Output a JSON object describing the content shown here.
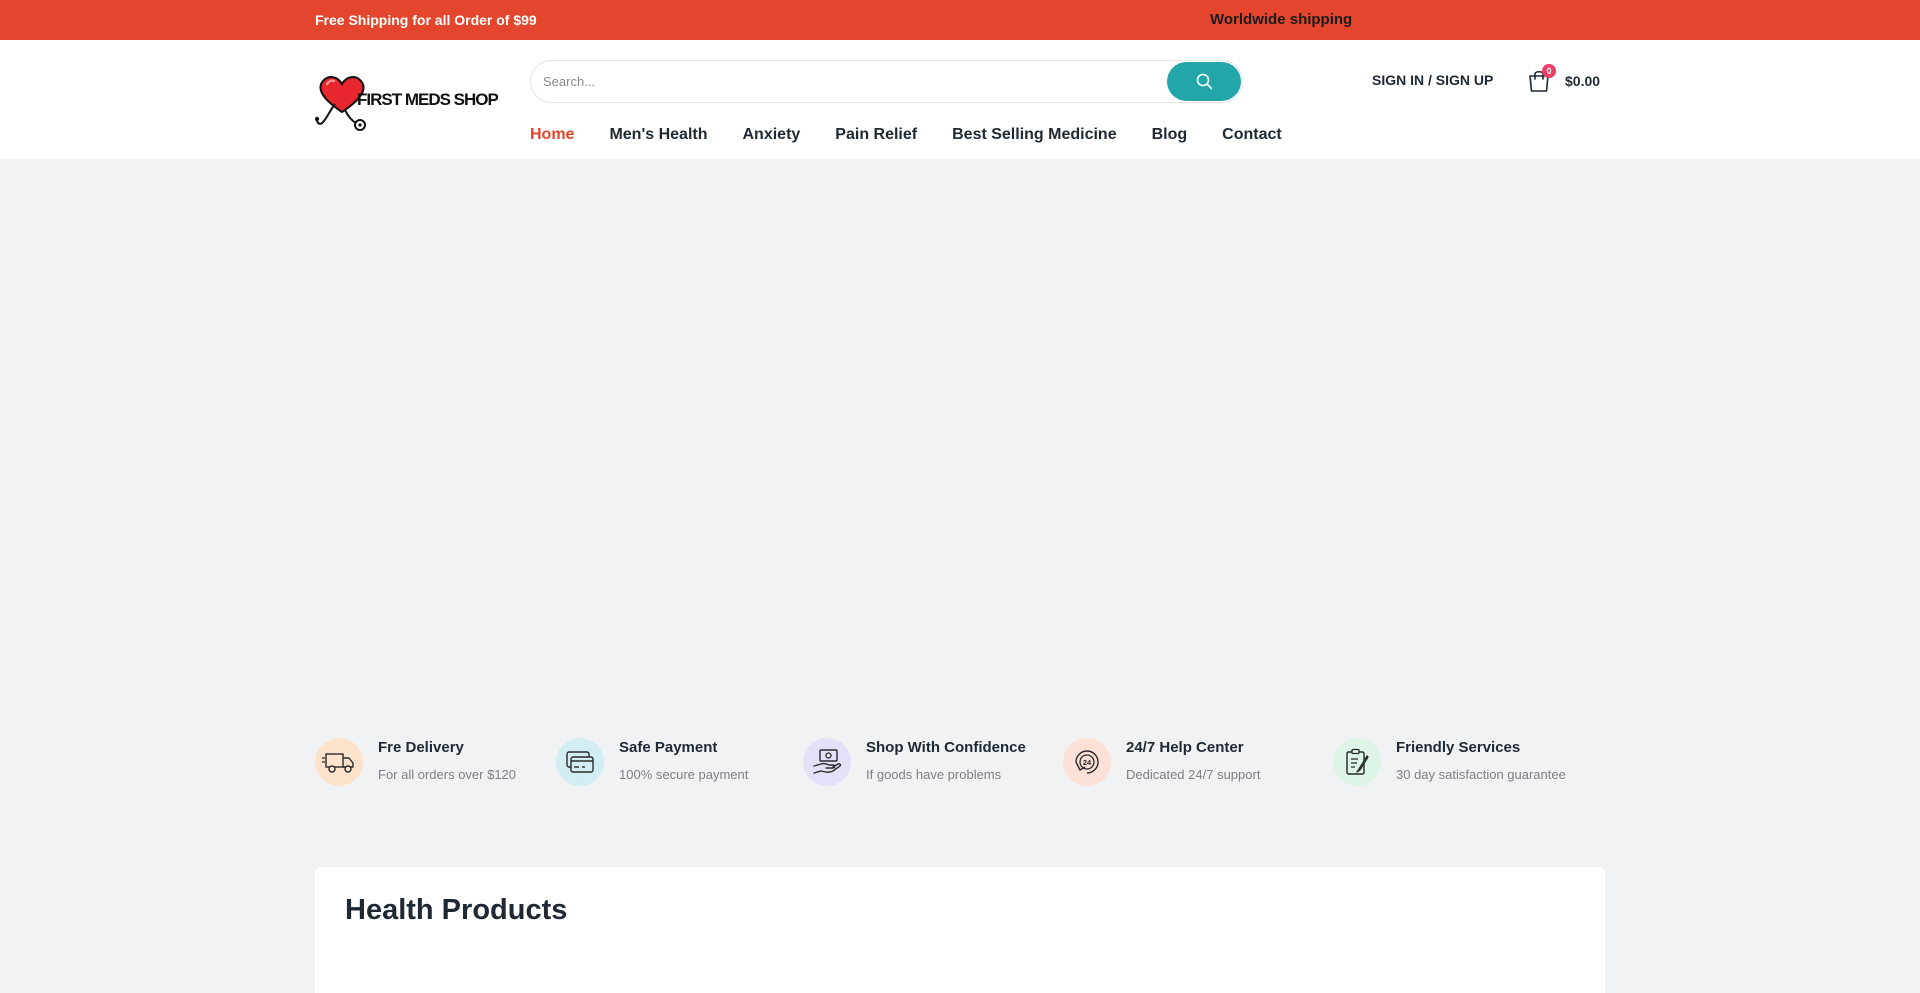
{
  "topbar": {
    "promo": "Free Shipping for all Order of $99",
    "shipping": "Worldwide shipping",
    "background": "#e3462c"
  },
  "header": {
    "logo_text": "FIRST MEDS SHOP",
    "search": {
      "placeholder": "Search...",
      "value": "",
      "button_icon": "search-icon",
      "button_color": "#22a6a9"
    },
    "signin_label": "SIGN IN / SIGN UP",
    "cart": {
      "icon": "shopping-bag-icon",
      "count": "0",
      "total": "$0.00"
    }
  },
  "nav": {
    "items": [
      {
        "label": "Home",
        "active": true
      },
      {
        "label": "Men's Health",
        "active": false
      },
      {
        "label": "Anxiety",
        "active": false
      },
      {
        "label": "Pain Relief",
        "active": false
      },
      {
        "label": "Best Selling Medicine",
        "active": false
      },
      {
        "label": "Blog",
        "active": false
      },
      {
        "label": "Contact",
        "active": false
      }
    ]
  },
  "features": [
    {
      "title": "Fre Delivery",
      "desc": "For all orders over $120",
      "icon": "truck-icon",
      "bg": "#fde3cc"
    },
    {
      "title": "Safe Payment",
      "desc": "100% secure payment",
      "icon": "credit-card-icon",
      "bg": "#d3eef3"
    },
    {
      "title": "Shop With Confidence",
      "desc": "If goods have problems",
      "icon": "hand-money-icon",
      "bg": "#e3e1f8"
    },
    {
      "title": "24/7 Help Center",
      "desc": "Dedicated 24/7 support",
      "icon": "support-24-icon",
      "bg": "#fde0d6"
    },
    {
      "title": "Friendly Services",
      "desc": "30 day satisfaction guarantee",
      "icon": "clipboard-icon",
      "bg": "#dcf5e6"
    }
  ],
  "products": {
    "title": "Health Products"
  }
}
